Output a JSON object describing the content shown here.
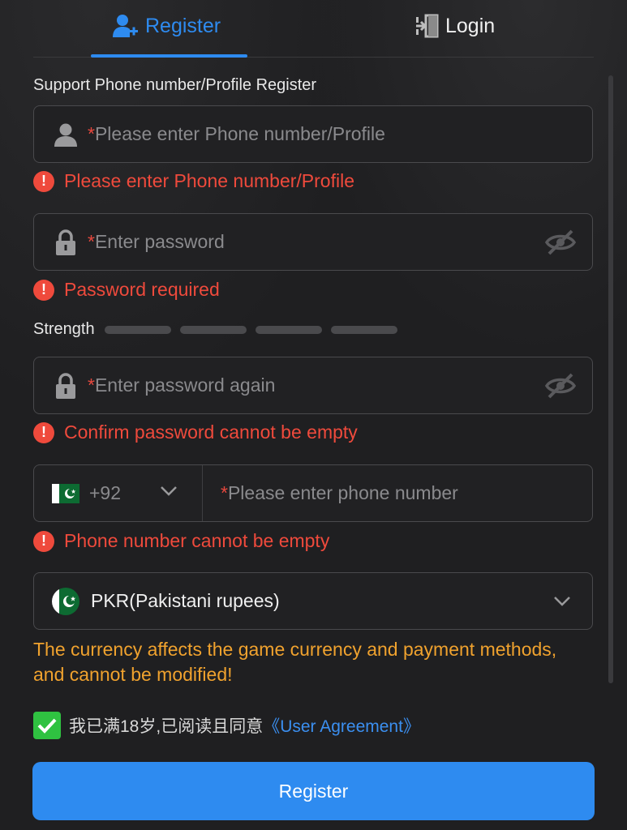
{
  "tabs": {
    "register_label": "Register",
    "login_label": "Login",
    "active": "register",
    "accent_color": "#2e8bf0"
  },
  "form": {
    "section_label": "Support Phone number/Profile Register",
    "required_mark": "*",
    "account": {
      "placeholder": "Please enter Phone number/Profile",
      "value": "",
      "icon": "user-icon",
      "error": "Please enter Phone number/Profile"
    },
    "password": {
      "placeholder": "Enter password",
      "value": "",
      "icon": "lock-icon",
      "toggle_icon": "eye-off-icon",
      "error": "Password required"
    },
    "strength": {
      "label": "Strength",
      "segments": 4,
      "filled": 0
    },
    "confirm_password": {
      "placeholder": "Enter password again",
      "value": "",
      "icon": "lock-icon",
      "toggle_icon": "eye-off-icon",
      "error": "Confirm password cannot be empty"
    },
    "phone": {
      "country_flag": "pakistan-flag-icon",
      "country_code": "+92",
      "placeholder": "Please enter phone number",
      "value": "",
      "error": "Phone number cannot be empty"
    },
    "currency": {
      "flag": "pakistan-flag-icon",
      "selected": "PKR(Pakistani rupees)",
      "note": "The currency affects the game currency and payment methods, and cannot be modified!"
    },
    "agreement": {
      "checked": true,
      "text": "我已满18岁,已阅读且同意",
      "link_text": "《User Agreement》"
    },
    "submit_label": "Register"
  },
  "colors": {
    "error": "#ef4a3c",
    "warning": "#f0a22e",
    "primary": "#2e8bf0",
    "checkbox": "#2fc241"
  }
}
